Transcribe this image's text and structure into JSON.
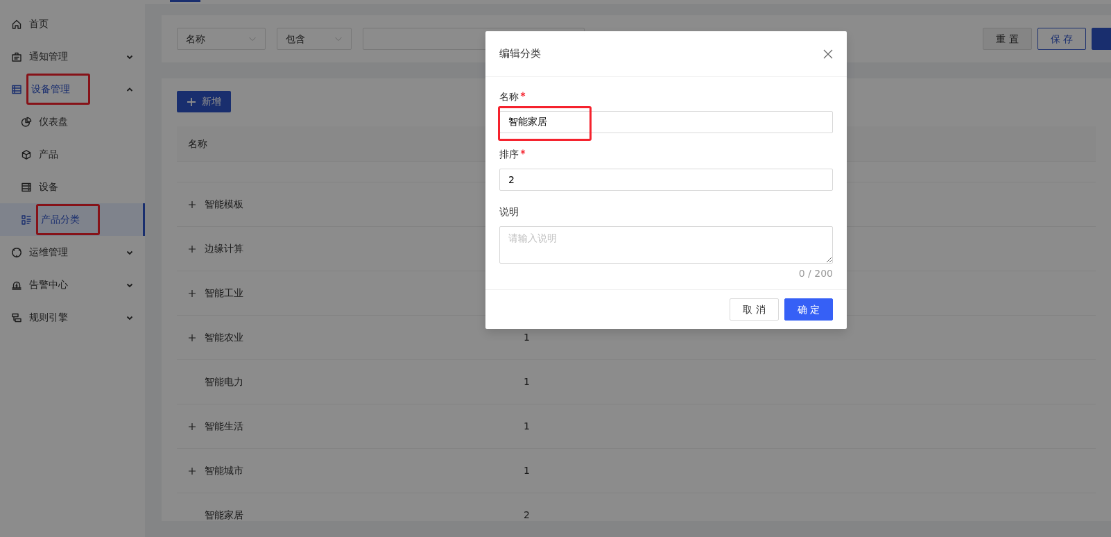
{
  "top_tabs": [
    {
      "selected": true
    }
  ],
  "sidebar": {
    "items": [
      {
        "label": "首页",
        "selected": false,
        "highlighted": false
      },
      {
        "label": "通知管理",
        "selected": false,
        "highlighted": false,
        "expanded": false
      },
      {
        "label": "设备管理",
        "selected": false,
        "highlighted": true,
        "expanded": true,
        "children": [
          {
            "label": "仪表盘",
            "selected": false,
            "highlighted": false
          },
          {
            "label": "产品",
            "selected": false,
            "highlighted": false
          },
          {
            "label": "设备",
            "selected": false,
            "highlighted": false
          },
          {
            "label": "产品分类",
            "selected": true,
            "highlighted": true
          }
        ]
      },
      {
        "label": "运维管理",
        "selected": false,
        "highlighted": false,
        "expanded": false
      },
      {
        "label": "告警中心",
        "selected": false,
        "highlighted": false,
        "expanded": false
      },
      {
        "label": "规则引擎",
        "selected": false,
        "highlighted": false,
        "expanded": false
      }
    ]
  },
  "filter": {
    "field": "名称",
    "operator": "包含",
    "buttons": [
      {
        "label": "重 置",
        "kind": "default"
      },
      {
        "label": "保 存",
        "kind": "outline"
      },
      {
        "kind": "primary"
      }
    ]
  },
  "table": {
    "add_button": "新增",
    "columns": [
      "名称"
    ],
    "rows": [
      {
        "name": "智能模板",
        "expandable": true
      },
      {
        "name": "边缘计算",
        "expandable": true
      },
      {
        "name": "智能工业",
        "expandable": true
      },
      {
        "name": "智能农业",
        "expandable": true,
        "column_2": "1"
      },
      {
        "name": "智能电力",
        "expandable": false,
        "column_2": "1"
      },
      {
        "name": "智能生活",
        "expandable": true,
        "column_2": "1"
      },
      {
        "name": "智能城市",
        "expandable": true,
        "column_2": "1"
      },
      {
        "name": "智能家居",
        "expandable": false,
        "column_2": "2"
      }
    ]
  },
  "modal": {
    "title": "编辑分类",
    "fields": [
      {
        "kind": "input",
        "label": "名称",
        "required": true,
        "value": "智能家居",
        "highlighted": true
      },
      {
        "kind": "input",
        "label": "排序",
        "required": true,
        "value": "2",
        "highlighted": false
      },
      {
        "kind": "textarea",
        "label": "说明",
        "required": false,
        "placeholder": "请输入说明",
        "counter": "0 / 200",
        "highlighted": false
      }
    ],
    "buttons": [
      {
        "label": "取 消",
        "kind": "default"
      },
      {
        "label": "确 定",
        "kind": "primary"
      }
    ]
  }
}
